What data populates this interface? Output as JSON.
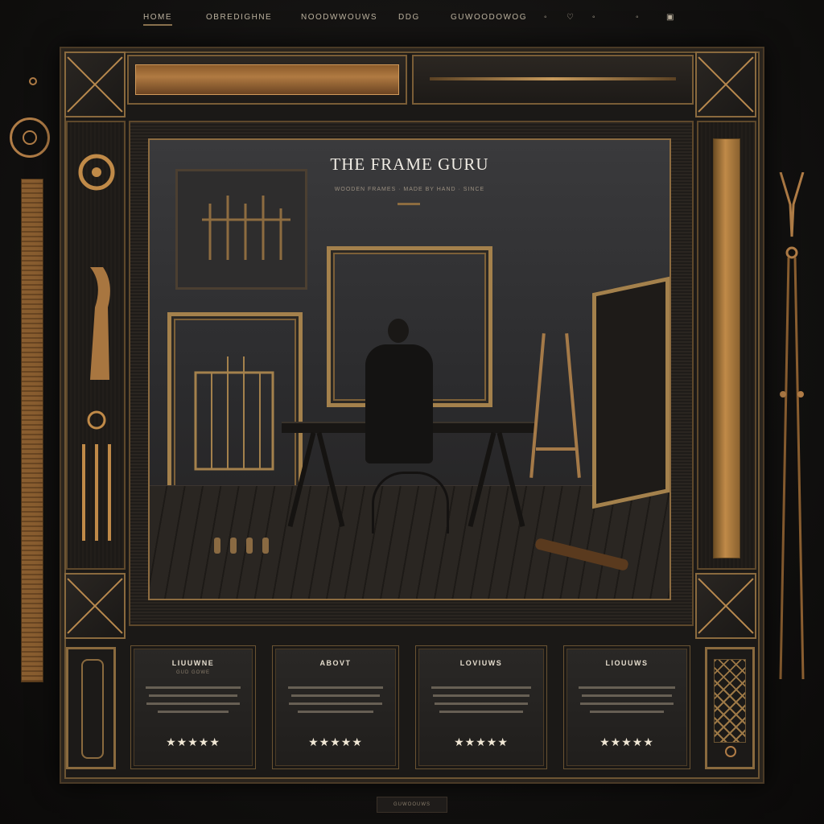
{
  "nav": {
    "items": [
      {
        "label": "HOME",
        "active": true
      },
      {
        "label": "OBREDIGHNE",
        "active": false
      },
      {
        "label": "NOODWWOUWS",
        "active": false
      },
      {
        "label": "DDG",
        "active": false
      },
      {
        "label": "GUWOODOWOG",
        "active": false
      }
    ],
    "icons": [
      "dot-icon",
      "heart-icon",
      "dot-icon",
      "dot-icon",
      "cart-icon"
    ]
  },
  "hero": {
    "title": "THE FRAME GURU",
    "subtitle": "WOODEN FRAMES · MADE BY HAND · SINCE"
  },
  "cards": [
    {
      "title": "LIUUWNE",
      "subtitle": "GUD GOWE",
      "stars": "★★★★★"
    },
    {
      "title": "ABOVT",
      "subtitle": "",
      "stars": "★★★★★"
    },
    {
      "title": "LOVIUWS",
      "subtitle": "",
      "stars": "★★★★★"
    },
    {
      "title": "LIOUUWS",
      "subtitle": "",
      "stars": "★★★★★"
    }
  ],
  "footer": {
    "badge": "GUWOOUWS"
  },
  "colors": {
    "accent": "#b07c46",
    "gold": "#c08a48",
    "background": "#121110",
    "panel": "#2a2826"
  }
}
